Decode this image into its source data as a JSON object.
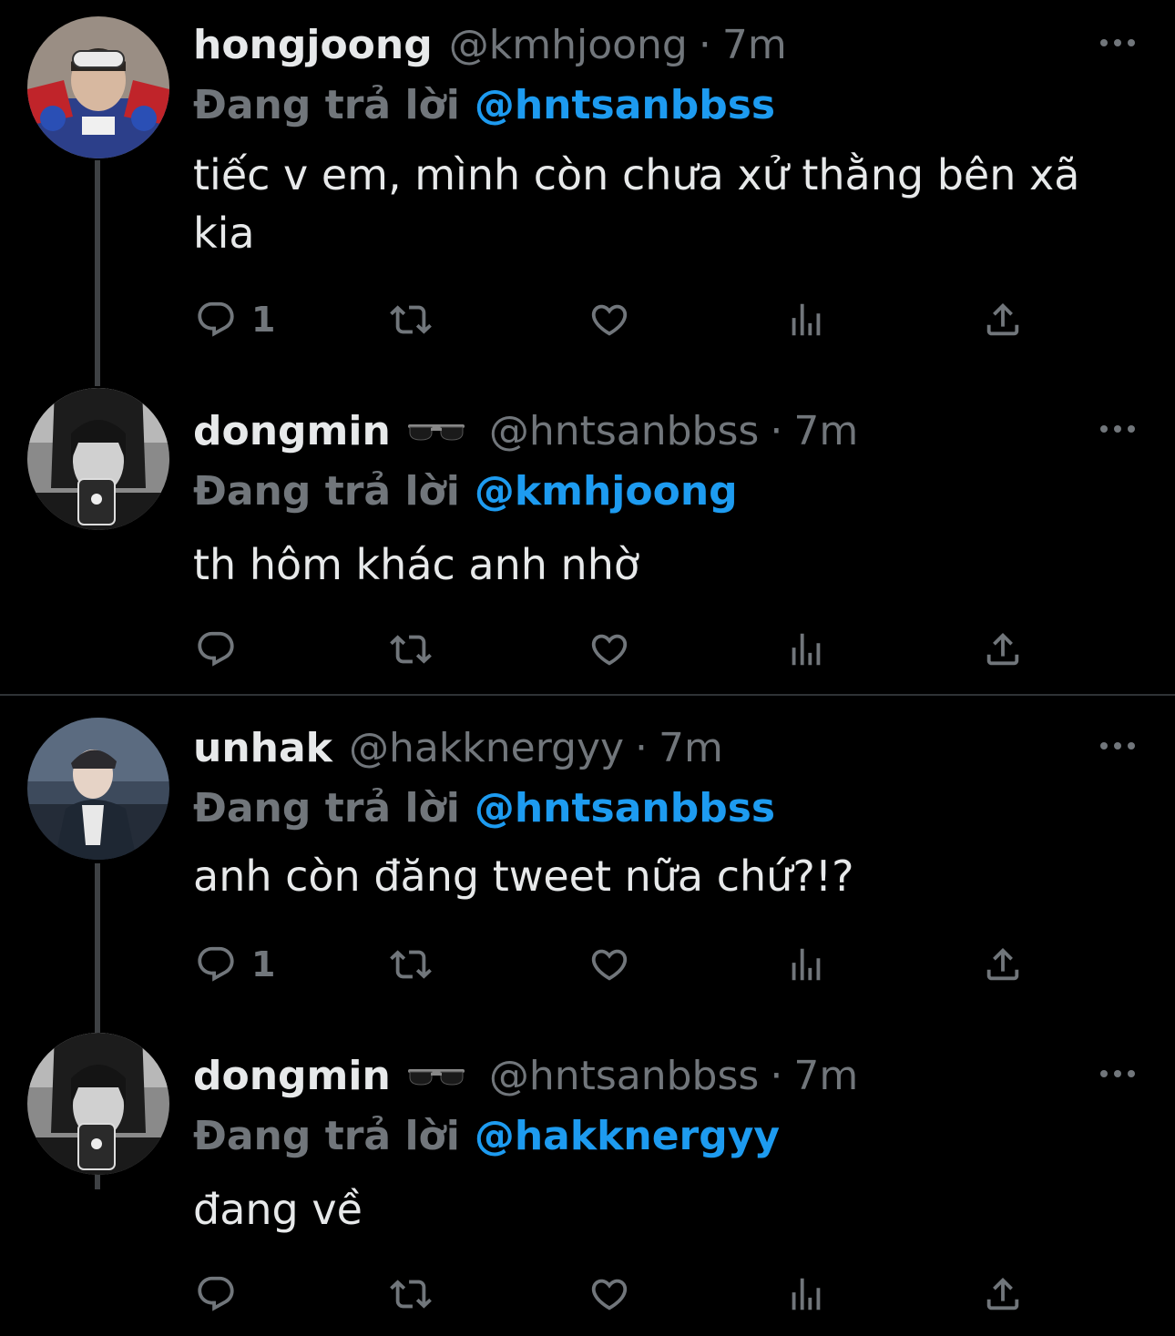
{
  "colors": {
    "background": "#000000",
    "text": "#e7e9ea",
    "muted": "#71767b",
    "link": "#1d9bf0",
    "thread_line": "#3e4144",
    "divider": "#2f3336"
  },
  "tweets": [
    {
      "name": "hongjoong",
      "emoji": "",
      "handle": "@kmhjoong",
      "dot": "·",
      "time": "7m",
      "reply_label": "Đang trả lời",
      "reply_to": "@hntsanbbss",
      "text": "tiếc v em, mình còn chưa xử thằng bên xã kia",
      "reply_count": "1",
      "avatar_icon": "avatar-photo"
    },
    {
      "name": "dongmin",
      "emoji": "sunglasses-emoji",
      "handle": "@hntsanbbss",
      "dot": "·",
      "time": "7m",
      "reply_label": "Đang trả lời",
      "reply_to": "@kmhjoong",
      "text": "th hôm khác anh nhờ",
      "reply_count": "",
      "avatar_icon": "avatar-photo"
    },
    {
      "name": "unhak",
      "emoji": "",
      "handle": "@hakknergyy",
      "dot": "·",
      "time": "7m",
      "reply_label": "Đang trả lời",
      "reply_to": "@hntsanbbss",
      "text": "anh còn đăng tweet nữa chứ?!?",
      "reply_count": "1",
      "avatar_icon": "avatar-photo"
    },
    {
      "name": "dongmin",
      "emoji": "sunglasses-emoji",
      "handle": "@hntsanbbss",
      "dot": "·",
      "time": "7m",
      "reply_label": "Đang trả lời",
      "reply_to": "@hakknergyy",
      "text": "đang về",
      "reply_count": "",
      "avatar_icon": "avatar-photo"
    }
  ],
  "action_icons": [
    "reply-icon",
    "retweet-icon",
    "like-icon",
    "views-icon",
    "share-icon"
  ]
}
